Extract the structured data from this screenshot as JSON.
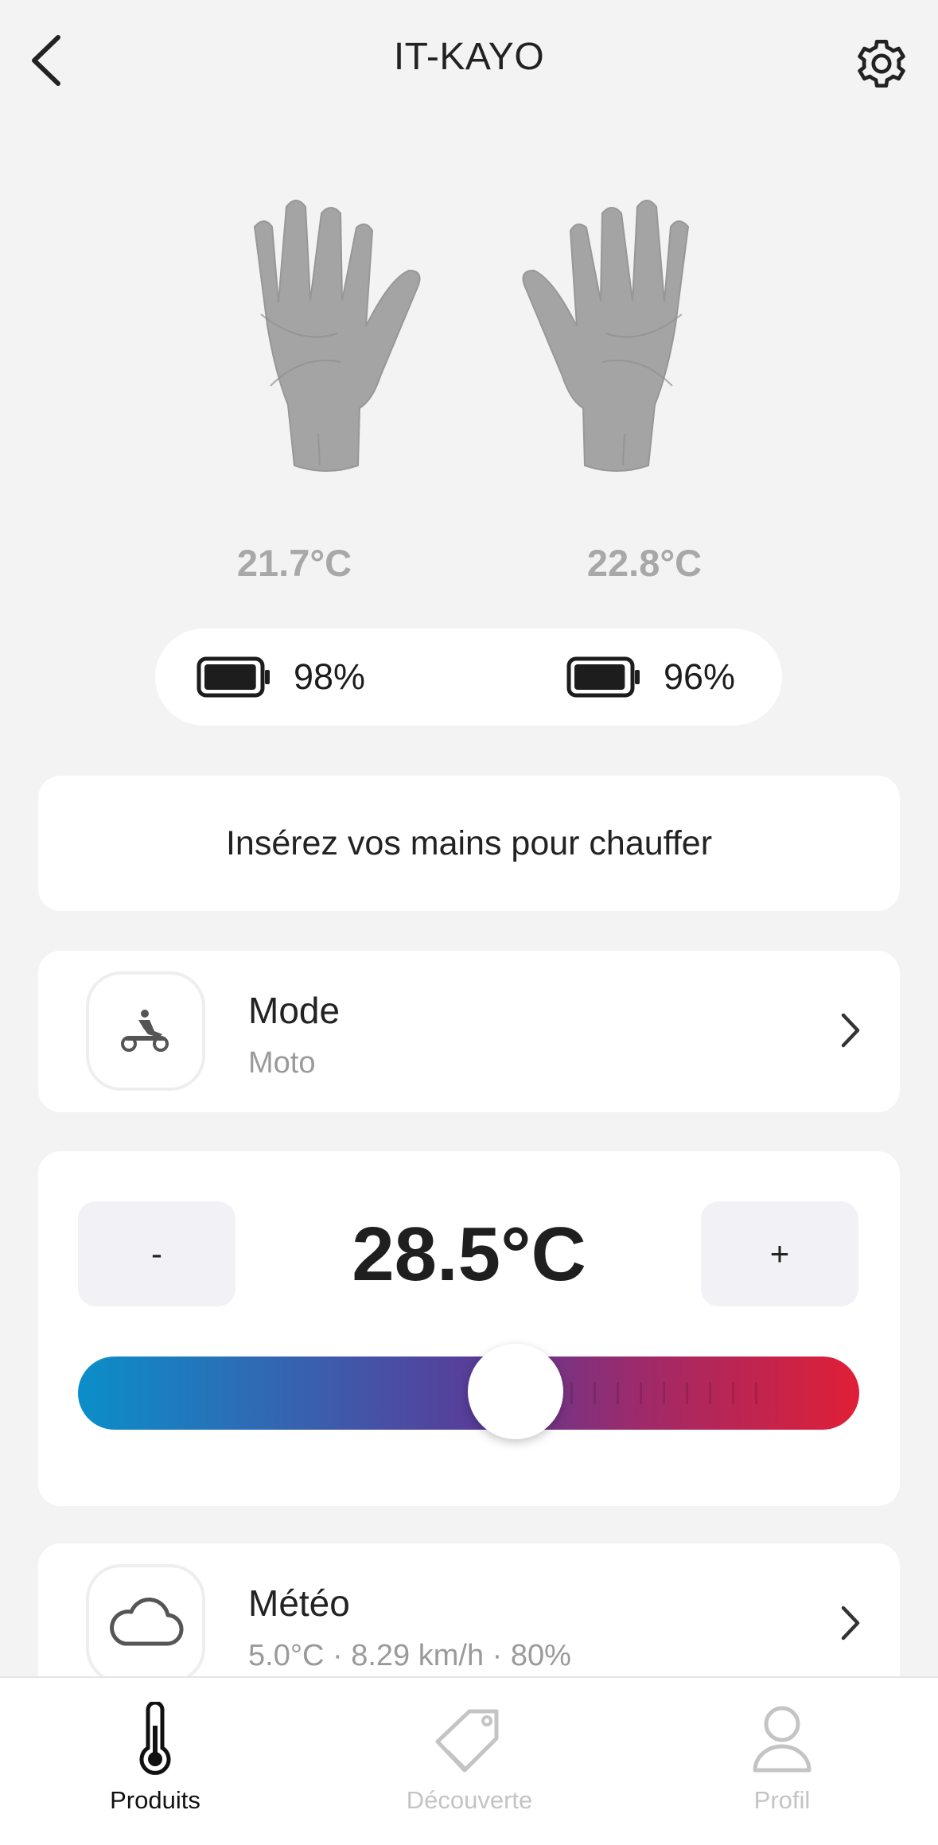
{
  "header": {
    "title": "IT-KAYO",
    "back_icon": "chevron-left-icon",
    "settings_icon": "gear-icon"
  },
  "gloves": {
    "left": {
      "temperature": "21.7°C",
      "battery": "98%",
      "battery_level": 0.98
    },
    "right": {
      "temperature": "22.8°C",
      "battery": "96%",
      "battery_level": 0.96
    }
  },
  "info": {
    "message": "Insérez vos mains pour chauffer"
  },
  "mode": {
    "title": "Mode",
    "value": "Moto",
    "icon": "motorcycle-icon"
  },
  "temperature_control": {
    "minus_label": "-",
    "plus_label": "+",
    "set_value": "28.5°C",
    "slider_fraction": 0.56
  },
  "weather": {
    "title": "Météo",
    "summary": "5.0°C · 8.29 km/h · 80%",
    "icon": "cloud-icon"
  },
  "bottom_nav": {
    "items": [
      {
        "label": "Produits",
        "icon": "thermometer-icon",
        "active": true
      },
      {
        "label": "Découverte",
        "icon": "tag-icon",
        "active": false
      },
      {
        "label": "Profil",
        "icon": "user-icon",
        "active": false
      }
    ]
  },
  "colors": {
    "background": "#f3f3f3",
    "slider_start": "#0a8fc9",
    "slider_mid": "#5a3b98",
    "slider_end": "#e01f36"
  }
}
